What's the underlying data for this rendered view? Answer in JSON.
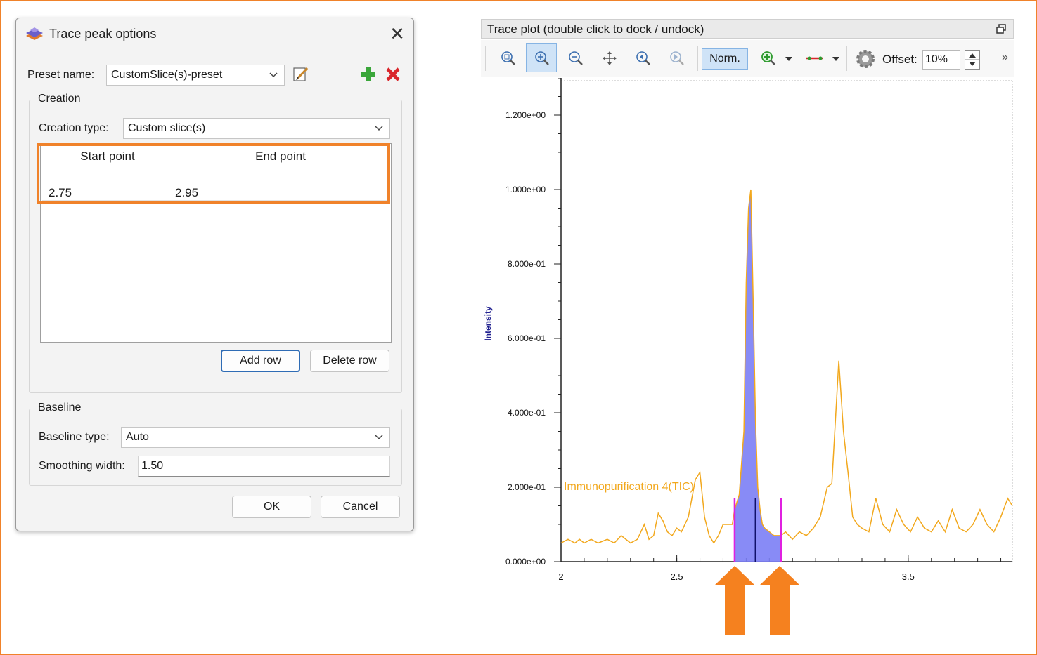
{
  "dialog": {
    "title": "Trace peak options",
    "preset_label": "Preset name:",
    "preset_value": "CustomSlice(s)-preset",
    "creation_group": "Creation",
    "creation_type_label": "Creation type:",
    "creation_type_value": "Custom slice(s)",
    "table": {
      "headers": [
        "Start point",
        "End point"
      ],
      "rows": [
        [
          "2.75",
          "2.95"
        ]
      ]
    },
    "add_row_label": "Add row",
    "delete_row_label": "Delete row",
    "baseline_group": "Baseline",
    "baseline_type_label": "Baseline type:",
    "baseline_type_value": "Auto",
    "smoothing_label": "Smoothing width:",
    "smoothing_value": "1.50",
    "ok_label": "OK",
    "cancel_label": "Cancel"
  },
  "plot": {
    "title": "Trace plot (double click to dock / undock)",
    "norm_label": "Norm.",
    "offset_label": "Offset:",
    "offset_value": "10%",
    "more_label": "»"
  },
  "colors": {
    "highlight": "#f0822a",
    "trace": "#f2a81d",
    "fill": "#7b7ef5",
    "slice_marker": "#e020e0",
    "accent": "#2f6cb5"
  },
  "chart_data": {
    "type": "line",
    "ylabel": "Intensity",
    "xlabel": "",
    "series": [
      {
        "name": "Immunopurification 4(TIC)",
        "x": [
          2.0,
          2.03,
          2.06,
          2.08,
          2.1,
          2.13,
          2.16,
          2.2,
          2.23,
          2.26,
          2.3,
          2.33,
          2.36,
          2.38,
          2.4,
          2.42,
          2.44,
          2.46,
          2.48,
          2.5,
          2.52,
          2.55,
          2.58,
          2.6,
          2.62,
          2.64,
          2.66,
          2.68,
          2.7,
          2.72,
          2.74,
          2.75,
          2.77,
          2.79,
          2.8,
          2.81,
          2.82,
          2.83,
          2.84,
          2.85,
          2.86,
          2.87,
          2.88,
          2.9,
          2.92,
          2.95,
          2.97,
          3.0,
          3.03,
          3.06,
          3.09,
          3.12,
          3.15,
          3.17,
          3.2,
          3.22,
          3.24,
          3.26,
          3.28,
          3.3,
          3.33,
          3.36,
          3.39,
          3.42,
          3.45,
          3.48,
          3.51,
          3.54,
          3.57,
          3.6,
          3.63,
          3.66,
          3.69,
          3.72,
          3.75,
          3.78,
          3.81,
          3.84,
          3.87,
          3.9,
          3.93,
          3.95
        ],
        "y": [
          0.05,
          0.06,
          0.05,
          0.06,
          0.05,
          0.06,
          0.05,
          0.06,
          0.05,
          0.07,
          0.05,
          0.06,
          0.1,
          0.06,
          0.07,
          0.13,
          0.11,
          0.08,
          0.07,
          0.09,
          0.08,
          0.12,
          0.22,
          0.24,
          0.12,
          0.07,
          0.05,
          0.07,
          0.1,
          0.1,
          0.1,
          0.14,
          0.18,
          0.35,
          0.75,
          0.95,
          1.0,
          0.7,
          0.38,
          0.2,
          0.14,
          0.1,
          0.09,
          0.08,
          0.07,
          0.07,
          0.08,
          0.06,
          0.08,
          0.07,
          0.09,
          0.12,
          0.2,
          0.21,
          0.54,
          0.35,
          0.24,
          0.12,
          0.1,
          0.09,
          0.08,
          0.17,
          0.1,
          0.08,
          0.14,
          0.1,
          0.08,
          0.12,
          0.09,
          0.08,
          0.11,
          0.08,
          0.14,
          0.09,
          0.08,
          0.1,
          0.14,
          0.1,
          0.08,
          0.12,
          0.17,
          0.15
        ]
      }
    ],
    "xlim": [
      2.0,
      3.95
    ],
    "ylim": [
      0.0,
      1.3
    ],
    "xticks": [
      {
        "value": 2.0,
        "label": "2"
      },
      {
        "value": 2.5,
        "label": "2.5"
      },
      {
        "value": 3.5,
        "label": "3.5"
      }
    ],
    "yticks": [
      {
        "value": 0.0,
        "label": "0.000e+00"
      },
      {
        "value": 0.2,
        "label": "2.000e-01"
      },
      {
        "value": 0.4,
        "label": "4.000e-01"
      },
      {
        "value": 0.6,
        "label": "6.000e-01"
      },
      {
        "value": 0.8,
        "label": "8.000e-01"
      },
      {
        "value": 1.0,
        "label": "1.000e+00"
      },
      {
        "value": 1.2,
        "label": "1.200e+00"
      }
    ],
    "slice": {
      "start": 2.75,
      "end": 2.95,
      "apex": 2.84,
      "marker_height": 0.17
    },
    "annotations": [
      "Immunopurification 4(TIC)"
    ]
  }
}
